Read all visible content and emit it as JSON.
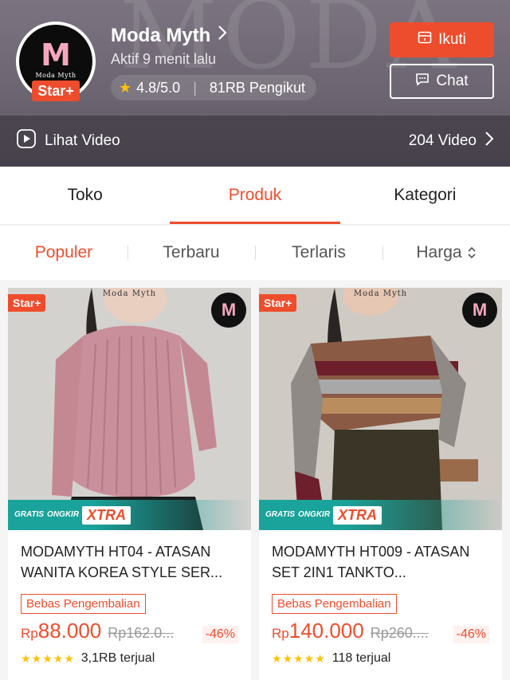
{
  "shop": {
    "name": "Moda Myth",
    "logo_letter": "M",
    "logo_sub": "Moda Myth",
    "badge": "Star+",
    "active": "Aktif 9 menit lalu",
    "rating": "4.8/5.0",
    "followers": "81RB Pengikut",
    "follow_label": "Ikuti",
    "chat_label": "Chat",
    "video_label": "Lihat Video",
    "video_count": "204 Video",
    "watermark": "MODA",
    "accent": "#ee4d2d"
  },
  "tabs": [
    {
      "label": "Toko"
    },
    {
      "label": "Produk"
    },
    {
      "label": "Kategori"
    }
  ],
  "sorts": [
    {
      "label": "Populer"
    },
    {
      "label": "Terbaru"
    },
    {
      "label": "Terlaris"
    },
    {
      "label": "Harga"
    }
  ],
  "products": [
    {
      "badge": "Star+",
      "brand": "Moda Myth",
      "logo": "M",
      "shipping_1": "GRATIS",
      "shipping_2": "ONGKIR",
      "shipping_3": "XTRA",
      "title": "MODAMYTH HT04 - ATASAN WANITA KOREA STYLE SER...",
      "return_badge": "Bebas Pengembalian",
      "currency": "Rp",
      "price": "88.000",
      "original": "Rp162.0...",
      "discount": "-46%",
      "rating_stars": "★★★★★",
      "sold": "3,1RB terjual"
    },
    {
      "badge": "Star+",
      "brand": "Moda Myth",
      "logo": "M",
      "shipping_1": "GRATIS",
      "shipping_2": "ONGKIR",
      "shipping_3": "XTRA",
      "title": "MODAMYTH HT009 - ATASAN SET 2IN1 TANKTO...",
      "return_badge": "Bebas Pengembalian",
      "currency": "Rp",
      "price": "140.000",
      "original": "Rp260....",
      "discount": "-46%",
      "rating_stars": "★★★★★",
      "sold": "118 terjual"
    }
  ]
}
